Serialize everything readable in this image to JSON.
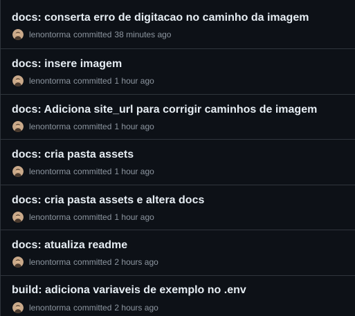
{
  "commits": [
    {
      "title": "docs: conserta erro de digitacao no caminho da imagem",
      "author": "lenontorma",
      "verb": "committed",
      "time": "38 minutes ago",
      "avatar_icon": "user-avatar-icon"
    },
    {
      "title": "docs: insere imagem",
      "author": "lenontorma",
      "verb": "committed",
      "time": "1 hour ago",
      "avatar_icon": "user-avatar-icon"
    },
    {
      "title": "docs: Adiciona site_url para corrigir caminhos de imagem",
      "author": "lenontorma",
      "verb": "committed",
      "time": "1 hour ago",
      "avatar_icon": "user-avatar-icon"
    },
    {
      "title": "docs: cria pasta assets",
      "author": "lenontorma",
      "verb": "committed",
      "time": "1 hour ago",
      "avatar_icon": "user-avatar-icon"
    },
    {
      "title": "docs: cria pasta assets e altera docs",
      "author": "lenontorma",
      "verb": "committed",
      "time": "1 hour ago",
      "avatar_icon": "user-avatar-icon"
    },
    {
      "title": "docs: atualiza readme",
      "author": "lenontorma",
      "verb": "committed",
      "time": "2 hours ago",
      "avatar_icon": "user-avatar-icon"
    },
    {
      "title": "build: adiciona variaveis de exemplo no .env",
      "author": "lenontorma",
      "verb": "committed",
      "time": "2 hours ago",
      "avatar_icon": "user-avatar-icon"
    }
  ],
  "colors": {
    "background": "#0d1117",
    "border": "#30363d",
    "title_text": "#e6edf3",
    "meta_text": "#8d96a0"
  }
}
